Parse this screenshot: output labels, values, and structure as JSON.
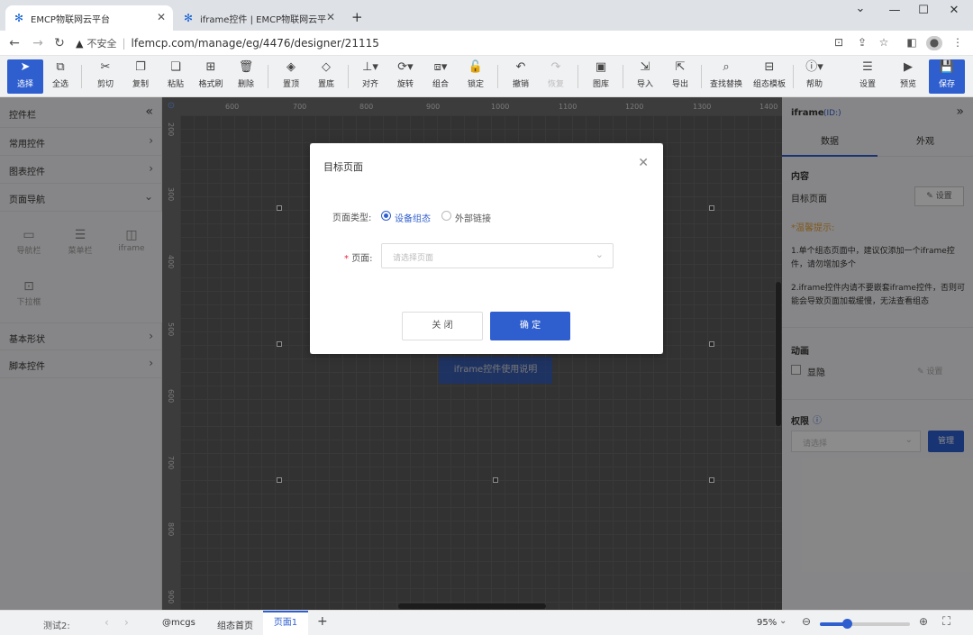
{
  "browser": {
    "tabs": [
      {
        "title": "EMCP物联网云平台",
        "active": true
      },
      {
        "title": "iframe控件 | EMCP物联网云平台",
        "active": false
      }
    ],
    "new_tab": "+",
    "security": "不安全",
    "url": "lfemcp.com/manage/eg/4476/designer/21115"
  },
  "toolbar": {
    "items": [
      {
        "label": "选择",
        "icon": "cursor-icon"
      },
      {
        "label": "全选",
        "icon": "select-all-icon"
      },
      {
        "label": "剪切",
        "icon": "scissors-icon"
      },
      {
        "label": "复制",
        "icon": "copy-icon"
      },
      {
        "label": "粘贴",
        "icon": "paste-icon"
      },
      {
        "label": "格式刷",
        "icon": "format-brush-icon"
      },
      {
        "label": "删除",
        "icon": "trash-icon"
      },
      {
        "label": "置顶",
        "icon": "bring-front-icon"
      },
      {
        "label": "置底",
        "icon": "send-back-icon"
      },
      {
        "label": "对齐",
        "icon": "align-icon"
      },
      {
        "label": "旋转",
        "icon": "rotate-icon"
      },
      {
        "label": "组合",
        "icon": "group-icon"
      },
      {
        "label": "锁定",
        "icon": "lock-icon"
      },
      {
        "label": "撤销",
        "icon": "undo-icon"
      },
      {
        "label": "恢复",
        "icon": "redo-icon"
      },
      {
        "label": "图库",
        "icon": "gallery-icon"
      },
      {
        "label": "导入",
        "icon": "import-icon"
      },
      {
        "label": "导出",
        "icon": "export-icon"
      },
      {
        "label": "查找替换",
        "icon": "find-replace-icon"
      },
      {
        "label": "组态模板",
        "icon": "template-icon"
      },
      {
        "label": "帮助",
        "icon": "help-icon"
      },
      {
        "label": "设置",
        "icon": "settings-icon"
      },
      {
        "label": "预览",
        "icon": "preview-icon"
      },
      {
        "label": "保存",
        "icon": "save-icon"
      }
    ]
  },
  "left_panel": {
    "title": "控件栏",
    "categories": [
      "常用控件",
      "图表控件",
      "页面导航",
      "基本形状",
      "脚本控件"
    ],
    "nav_items": [
      "导航栏",
      "菜单栏",
      "iframe",
      "下拉框"
    ]
  },
  "canvas": {
    "ruler_top": [
      "600",
      "700",
      "800",
      "900",
      "1000",
      "1100",
      "1200",
      "1300",
      "1400"
    ],
    "ruler_left": [
      "200",
      "300",
      "400",
      "500",
      "600",
      "700",
      "800",
      "900"
    ],
    "iframe_button": "iframe控件使用说明"
  },
  "right_panel": {
    "title": "iframe",
    "id_label": "(ID:)",
    "tabs": [
      "数据",
      "外观"
    ],
    "content_heading": "内容",
    "target_page_label": "目标页面",
    "set_button": "设置",
    "tip_heading": "*温馨提示:",
    "tip1": "1.单个组态页面中，建议仅添加一个iframe控件，请勿增加多个",
    "tip2": "2.iframe控件内请不要嵌套iframe控件，否则可能会导致页面加载缓慢，无法查看组态",
    "animation_heading": "动画",
    "hide_label": "显隐",
    "animation_set": "设置",
    "permission_heading": "权限",
    "permission_placeholder": "请选择",
    "manage_button": "管理"
  },
  "status_bar": {
    "test_label": "测试2:",
    "pages": [
      "@mcgs",
      "组态首页",
      "页面1"
    ],
    "active_page": "页面1",
    "zoom": "95%",
    "zoom_fraction": 0.3
  },
  "dialog": {
    "title": "目标页面",
    "page_type_label": "页面类型:",
    "option_device": "设备组态",
    "option_external": "外部链接",
    "page_label": "页面:",
    "page_placeholder": "请选择页面",
    "cancel": "关 闭",
    "confirm": "确 定"
  },
  "colors": {
    "accent": "#2f5fcf",
    "warning": "#e6a23c"
  }
}
